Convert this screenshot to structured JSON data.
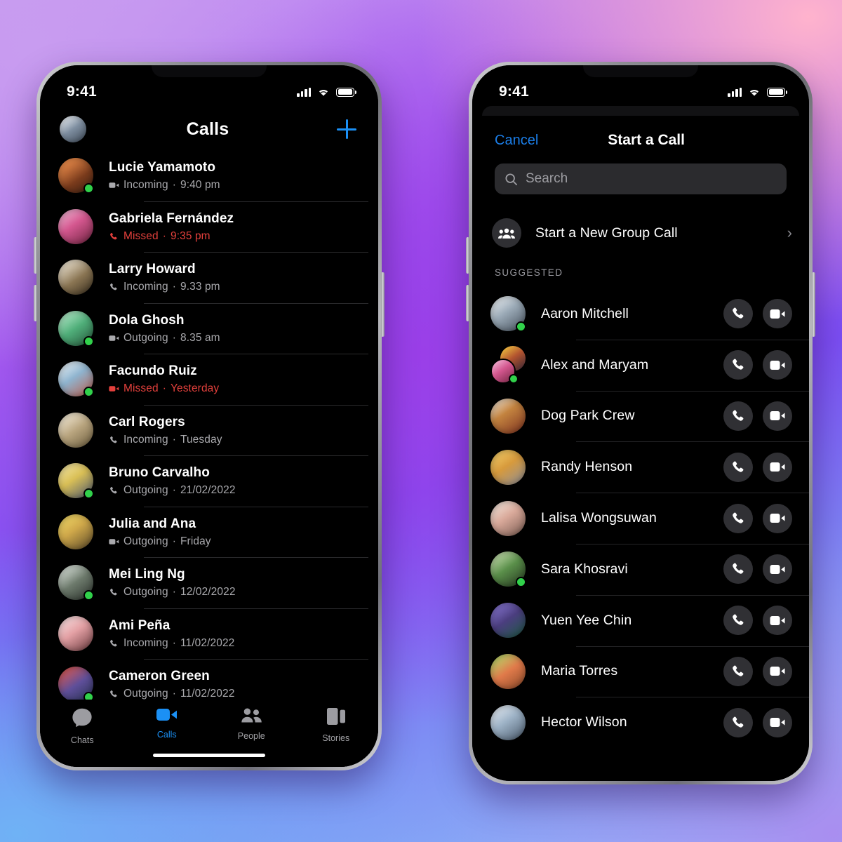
{
  "background": {
    "colors": [
      "#c99bf2",
      "#a157ef",
      "#7b4df2",
      "#8fc0f8",
      "#ffb3cd"
    ]
  },
  "accent": {
    "blue": "#1b90f5",
    "link_blue": "#1b7ee8",
    "missed_red": "#e3403c",
    "online_green": "#31d14b"
  },
  "left_phone": {
    "status": {
      "time": "9:41",
      "signal_icon": "cellular-signal-icon",
      "wifi_icon": "wifi-icon",
      "battery_icon": "battery-full-icon"
    },
    "nav": {
      "avatar_icon": "profile-avatar",
      "title": "Calls",
      "new_call_icon": "plus-icon"
    },
    "calls": [
      {
        "name": "Lucie Yamamoto",
        "type": "Incoming",
        "time": "9:40 pm",
        "icon": "video-incoming-icon",
        "missed": false,
        "online": true,
        "avatar": "av-b"
      },
      {
        "name": "Gabriela Fernández",
        "type": "Missed",
        "time": "9:35 pm",
        "icon": "phone-missed-icon",
        "missed": true,
        "online": false,
        "avatar": "av-c"
      },
      {
        "name": "Larry Howard",
        "type": "Incoming",
        "time": "9.33 pm",
        "icon": "phone-incoming-icon",
        "missed": false,
        "online": false,
        "avatar": "av-d"
      },
      {
        "name": "Dola Ghosh",
        "type": "Outgoing",
        "time": "8.35 am",
        "icon": "video-outgoing-icon",
        "missed": false,
        "online": true,
        "avatar": "av-e"
      },
      {
        "name": "Facundo Ruiz",
        "type": "Missed",
        "time": "Yesterday",
        "icon": "video-missed-icon",
        "missed": true,
        "online": true,
        "avatar": "av-f"
      },
      {
        "name": "Carl Rogers",
        "type": "Incoming",
        "time": "Tuesday",
        "icon": "phone-incoming-icon",
        "missed": false,
        "online": false,
        "avatar": "av-g"
      },
      {
        "name": "Bruno Carvalho",
        "type": "Outgoing",
        "time": "21/02/2022",
        "icon": "phone-outgoing-icon",
        "missed": false,
        "online": true,
        "avatar": "av-h"
      },
      {
        "name": "Julia and Ana",
        "type": "Outgoing",
        "time": "Friday",
        "icon": "video-outgoing-icon",
        "missed": false,
        "online": false,
        "avatar": "av-i"
      },
      {
        "name": "Mei Ling Ng",
        "type": "Outgoing",
        "time": "12/02/2022",
        "icon": "phone-outgoing-icon",
        "missed": false,
        "online": true,
        "avatar": "av-j"
      },
      {
        "name": "Ami Peña",
        "type": "Incoming",
        "time": "11/02/2022",
        "icon": "phone-incoming-icon",
        "missed": false,
        "online": false,
        "avatar": "av-k"
      },
      {
        "name": "Cameron Green",
        "type": "Outgoing",
        "time": "11/02/2022",
        "icon": "phone-outgoing-icon",
        "missed": false,
        "online": true,
        "avatar": "av-l"
      }
    ],
    "tabs": [
      {
        "label": "Chats",
        "icon": "chat-bubble-icon",
        "active": false
      },
      {
        "label": "Calls",
        "icon": "video-camera-icon",
        "active": true
      },
      {
        "label": "People",
        "icon": "people-icon",
        "active": false
      },
      {
        "label": "Stories",
        "icon": "stories-icon",
        "active": false
      }
    ]
  },
  "right_phone": {
    "status": {
      "time": "9:41",
      "signal_icon": "cellular-signal-icon",
      "wifi_icon": "wifi-icon",
      "battery_icon": "battery-full-icon"
    },
    "nav": {
      "cancel": "Cancel",
      "title": "Start a Call"
    },
    "search": {
      "placeholder": "Search",
      "value": "",
      "icon": "search-icon"
    },
    "group_call": {
      "label": "Start a New Group Call",
      "icon": "group-people-icon",
      "chevron": "chevron-right-icon"
    },
    "section_header": "SUGGESTED",
    "row_actions": {
      "audio": "phone-call-icon",
      "video": "video-call-icon"
    },
    "suggested": [
      {
        "name": "Aaron Mitchell",
        "online": true,
        "avatar": "av-m",
        "group": false
      },
      {
        "name": "Alex and Maryam",
        "online": true,
        "avatar": "av-n",
        "group": true
      },
      {
        "name": "Dog Park Crew",
        "online": false,
        "avatar": "av-o",
        "group": false
      },
      {
        "name": "Randy Henson",
        "online": false,
        "avatar": "av-p",
        "group": false
      },
      {
        "name": "Lalisa Wongsuwan",
        "online": false,
        "avatar": "av-q",
        "group": false
      },
      {
        "name": "Sara Khosravi",
        "online": true,
        "avatar": "av-r",
        "group": false
      },
      {
        "name": "Yuen Yee Chin",
        "online": false,
        "avatar": "av-s",
        "group": false
      },
      {
        "name": "Maria Torres",
        "online": false,
        "avatar": "av-t",
        "group": false
      },
      {
        "name": "Hector Wilson",
        "online": false,
        "avatar": "av-u",
        "group": false
      }
    ]
  }
}
